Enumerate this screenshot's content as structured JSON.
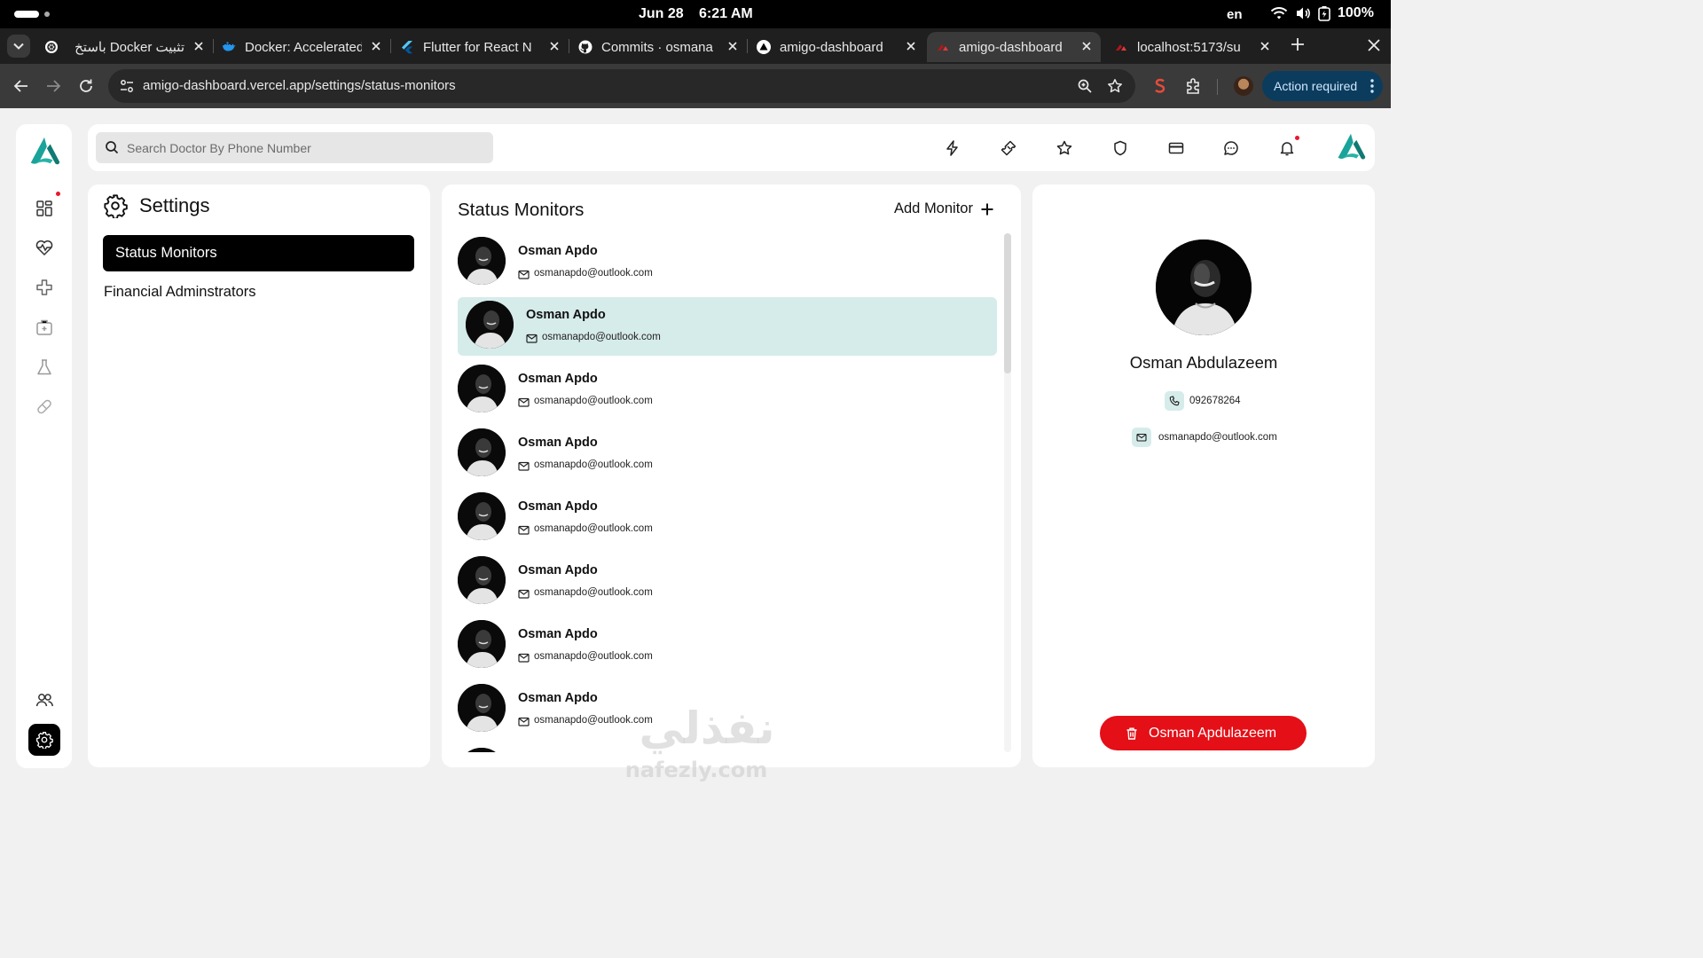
{
  "os": {
    "date": "Jun 28",
    "time": "6:21 AM",
    "lang": "en",
    "battery": "100%"
  },
  "browser": {
    "tabs": [
      {
        "label": "تثبيت Docker باستخ",
        "icon": "openai-icon"
      },
      {
        "label": "Docker: Accelerated",
        "icon": "docker-icon"
      },
      {
        "label": "Flutter for React N",
        "icon": "flutter-icon"
      },
      {
        "label": "Commits · osmana",
        "icon": "github-icon"
      },
      {
        "label": "amigo-dashboard",
        "icon": "vercel-icon"
      },
      {
        "label": "amigo-dashboard",
        "icon": "app-logo-icon",
        "active": true
      },
      {
        "label": "localhost:5173/su",
        "icon": "app-logo-icon"
      }
    ],
    "url": "amigo-dashboard.vercel.app/settings/status-monitors",
    "action_label": "Action required"
  },
  "search": {
    "placeholder": "Search Doctor By Phone Number"
  },
  "settings": {
    "title": "Settings",
    "menu": [
      {
        "label": "Status Monitors",
        "active": true
      },
      {
        "label": "Financial Adminstrators",
        "active": false
      }
    ]
  },
  "monitors": {
    "title": "Status Monitors",
    "add_label": "Add Monitor",
    "items": [
      {
        "name": "Osman Apdo",
        "email": "osmanapdo@outlook.com",
        "selected": false
      },
      {
        "name": "Osman Apdo",
        "email": "osmanapdo@outlook.com",
        "selected": true
      },
      {
        "name": "Osman Apdo",
        "email": "osmanapdo@outlook.com",
        "selected": false
      },
      {
        "name": "Osman Apdo",
        "email": "osmanapdo@outlook.com",
        "selected": false
      },
      {
        "name": "Osman Apdo",
        "email": "osmanapdo@outlook.com",
        "selected": false
      },
      {
        "name": "Osman Apdo",
        "email": "osmanapdo@outlook.com",
        "selected": false
      },
      {
        "name": "Osman Apdo",
        "email": "osmanapdo@outlook.com",
        "selected": false
      },
      {
        "name": "Osman Apdo",
        "email": "osmanapdo@outlook.com",
        "selected": false
      },
      {
        "name": "",
        "email": "",
        "selected": false
      }
    ]
  },
  "profile": {
    "name": "Osman Abdulazeem",
    "phone": "092678264",
    "email": "osmanapdo@outlook.com",
    "delete_label": "Osman Apdulazeem"
  },
  "watermark": {
    "arabic": "نفذلي",
    "latin": "nafezly.com"
  },
  "colors": {
    "brand": "#1aa39a",
    "selected_row": "#d6ecea",
    "danger": "#e40f17",
    "notification_dot": "#e8182b"
  }
}
